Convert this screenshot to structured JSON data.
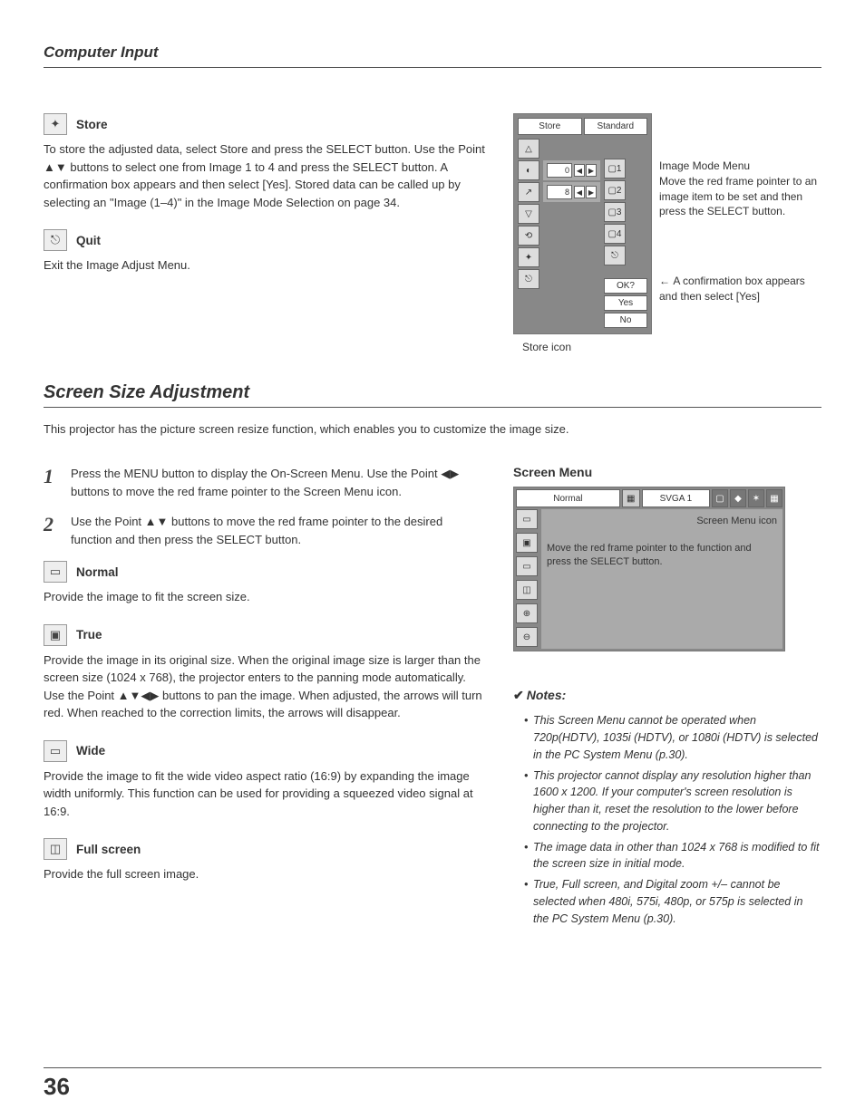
{
  "header": {
    "title": "Computer Input"
  },
  "store": {
    "label": "Store",
    "body": "To store the adjusted data, select Store and press the SELECT button. Use the Point ▲▼ buttons to select one from Image 1 to 4 and press the SELECT button. A confirmation box appears and then select [Yes]. Stored data can be called up by selecting an \"Image (1–4)\" in the Image Mode Selection on page 34."
  },
  "quit": {
    "label": "Quit",
    "body": "Exit the Image Adjust Menu."
  },
  "diagram1": {
    "tab_store": "Store",
    "tab_standard": "Standard",
    "value1": "0",
    "value2": "8",
    "ok": "OK?",
    "yes": "Yes",
    "no": "No",
    "callout_right": "Image Mode Menu\nMove the red frame pointer to an image item to be set and then press the SELECT button.",
    "callout_store": "Store icon",
    "callout_confirm": "A confirmation box appears and then select [Yes]"
  },
  "section": {
    "title": "Screen Size Adjustment",
    "intro": "This projector has the picture screen resize function, which enables you to customize the image size."
  },
  "steps": {
    "1": "Press the MENU button to display the On-Screen Menu. Use the Point ◀▶ buttons to move the red frame pointer to the Screen Menu icon.",
    "2": "Use the Point ▲▼ buttons to move the red frame pointer to the desired function and then press the SELECT button."
  },
  "normal": {
    "label": "Normal",
    "body": "Provide the image to fit the screen size."
  },
  "true_mode": {
    "label": "True",
    "body": "Provide the image in its original size. When the original image size is larger than the screen size (1024 x 768), the projector enters to the panning mode automatically. Use the Point ▲▼◀▶ buttons to pan the image. When adjusted, the arrows will turn red. When reached to the correction limits, the arrows will disappear."
  },
  "wide": {
    "label": "Wide",
    "body": "Provide the image to fit the wide video aspect ratio (16:9) by expanding the image width uniformly. This function can be used for providing a squeezed video signal at 16:9."
  },
  "fullscreen": {
    "label": "Full screen",
    "body": "Provide the full screen image."
  },
  "screen_menu": {
    "heading": "Screen Menu",
    "top_normal": "Normal",
    "top_svga": "SVGA 1",
    "label_icon": "Screen Menu icon",
    "label_move": "Move the red frame pointer to the function and press the SELECT button."
  },
  "notes": {
    "heading": "Notes:",
    "items": [
      "This Screen Menu cannot be operated when 720p(HDTV), 1035i (HDTV), or 1080i (HDTV) is selected in the PC System Menu (p.30).",
      "This projector cannot display any resolution higher than 1600 x 1200. If your computer's screen resolution is higher than it, reset the resolution to the lower before connecting to the projector.",
      "The image data in other than 1024 x 768 is modified to fit the screen size in initial mode.",
      "True, Full screen, and Digital zoom +/– cannot be selected when 480i, 575i, 480p, or 575p is selected in the PC System Menu (p.30)."
    ]
  },
  "page_number": "36"
}
